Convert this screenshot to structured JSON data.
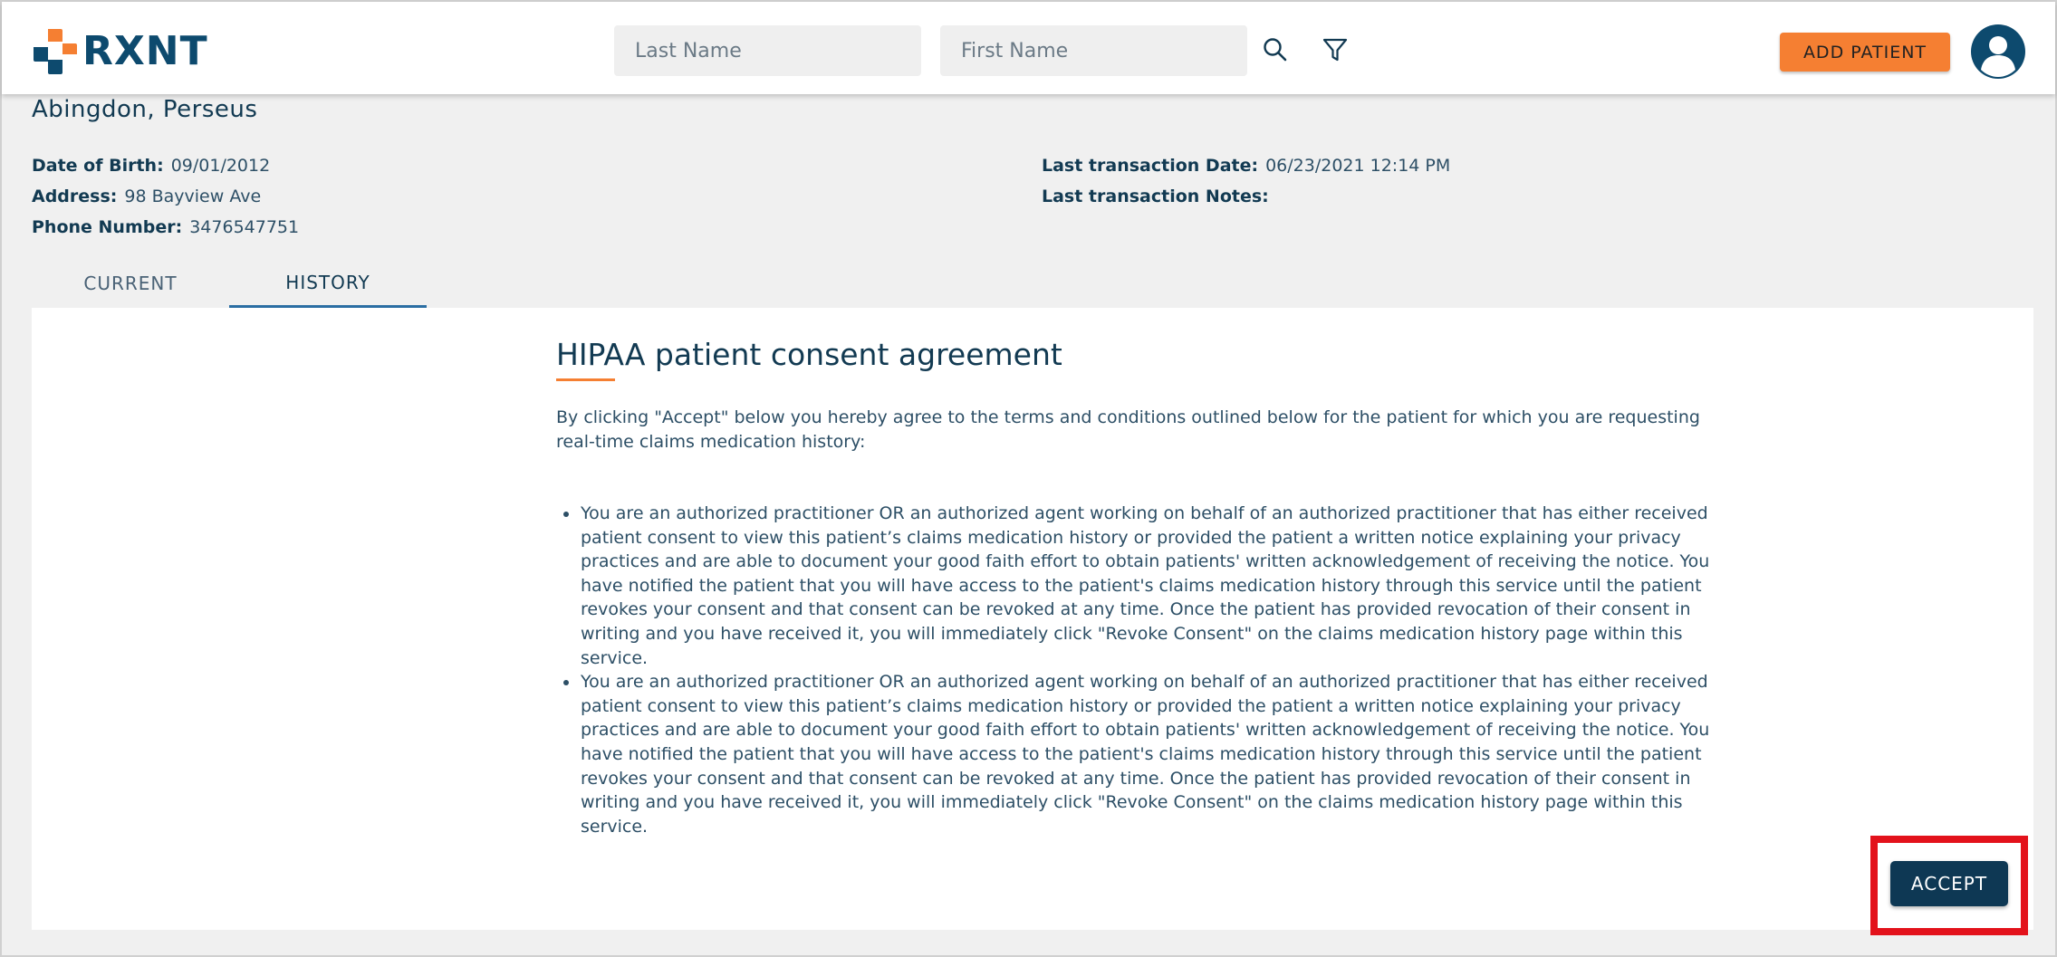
{
  "app": {
    "logo_text": "RXNT",
    "brand_colors": {
      "orange": "#f57f32",
      "navy": "#0d4a6e"
    }
  },
  "header": {
    "last_name_placeholder": "Last Name",
    "first_name_placeholder": "First Name",
    "search_icon": "search-icon",
    "filter_icon": "filter-icon",
    "add_patient_label": "ADD PATIENT",
    "avatar_icon": "user-avatar-icon"
  },
  "patient": {
    "name": "Abingdon, Perseus",
    "dob_label": "Date of Birth:",
    "dob": "09/01/2012",
    "address_label": "Address:",
    "address": "98 Bayview Ave",
    "phone_label": "Phone Number:",
    "phone": "3476547751",
    "last_tx_date_label": "Last transaction Date:",
    "last_tx_date": "06/23/2021 12:14 PM",
    "last_tx_notes_label": "Last transaction Notes:",
    "last_tx_notes": ""
  },
  "tabs": [
    {
      "label": "CURRENT",
      "active": false
    },
    {
      "label": "HISTORY",
      "active": true
    }
  ],
  "consent": {
    "title": "HIPAA patient consent agreement",
    "intro": "By clicking \"Accept\" below you hereby agree to the terms and conditions outlined below for the patient for which you are requesting real-time claims medication history:",
    "bullets": [
      "You are an authorized practitioner OR an authorized agent working on behalf of an authorized practitioner that has either received patient consent to view this patient’s claims medication history or provided the patient a written notice explaining your privacy practices and are able to document your good faith effort to obtain patients' written acknowledgement of receiving the notice. You have notified the patient that you will have access to the patient's claims medication history through this service until the patient revokes your consent and that consent can be revoked at any time. Once the patient has provided revocation of their consent in writing and you have received it, you will immediately click \"Revoke Consent\" on the claims medication history page within this service.",
      "You are an authorized practitioner OR an authorized agent working on behalf of an authorized practitioner that has either received patient consent to view this patient’s claims medication history or provided the patient a written notice explaining your privacy practices and are able to document your good faith effort to obtain patients' written acknowledgement of receiving the notice. You have notified the patient that you will have access to the patient's claims medication history through this service until the patient revokes your consent and that consent can be revoked at any time. Once the patient has provided revocation of their consent in writing and you have received it, you will immediately click \"Revoke Consent\" on the claims medication history page within this service."
    ],
    "accept_label": "ACCEPT",
    "highlight_color": "#e3121b"
  }
}
